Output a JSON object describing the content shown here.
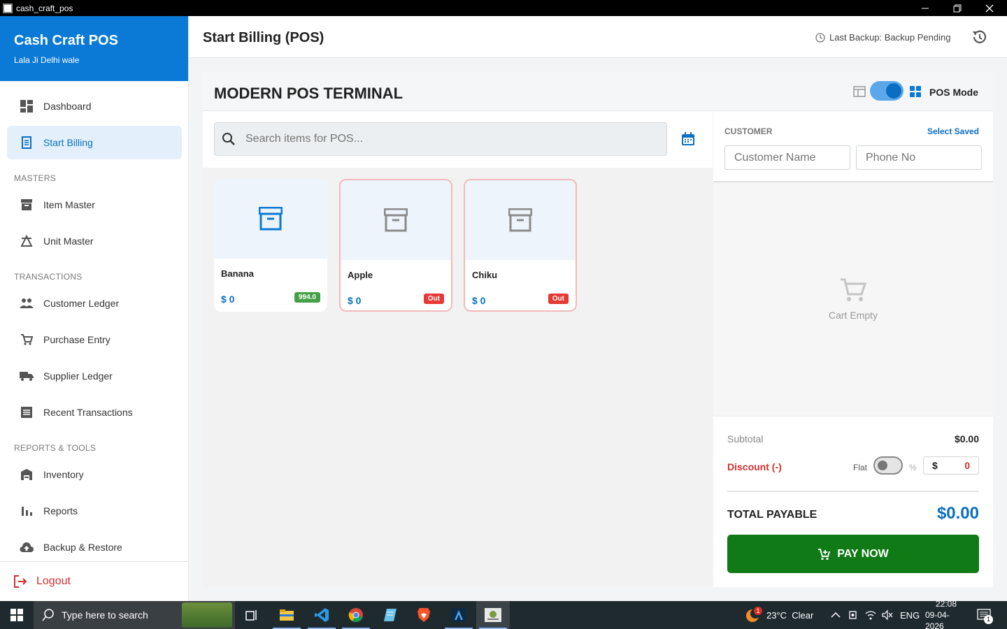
{
  "window": {
    "title": "cash_craft_pos"
  },
  "brand": {
    "name": "Cash Craft POS",
    "subtitle": "Lala Ji Delhi wale"
  },
  "nav": {
    "dashboard": "Dashboard",
    "start_billing": "Start Billing",
    "masters_section": "MASTERS",
    "item_master": "Item Master",
    "unit_master": "Unit Master",
    "transactions_section": "TRANSACTIONS",
    "customer_ledger": "Customer Ledger",
    "purchase_entry": "Purchase Entry",
    "supplier_ledger": "Supplier Ledger",
    "recent_transactions": "Recent Transactions",
    "reports_section": "REPORTS & TOOLS",
    "inventory": "Inventory",
    "reports": "Reports",
    "backup_restore": "Backup & Restore",
    "logout": "Logout"
  },
  "header": {
    "title": "Start Billing (POS)",
    "backup_status": "Last Backup: Backup Pending"
  },
  "terminal": {
    "title": "MODERN POS TERMINAL",
    "mode_label": "POS Mode",
    "pos_mode_on": true
  },
  "search": {
    "placeholder": "Search items for POS..."
  },
  "items": [
    {
      "name": "Banana",
      "price": "$ 0",
      "badge": "994.0",
      "status": "in-stock"
    },
    {
      "name": "Apple",
      "price": "$ 0",
      "badge": "Out",
      "status": "out-of-stock"
    },
    {
      "name": "Chiku",
      "price": "$ 0",
      "badge": "Out",
      "status": "out-of-stock"
    }
  ],
  "customer": {
    "label": "CUSTOMER",
    "select_saved": "Select Saved",
    "name_placeholder": "Customer Name",
    "phone_placeholder": "Phone No"
  },
  "cart": {
    "empty_text": "Cart Empty"
  },
  "totals": {
    "subtotal_label": "Subtotal",
    "subtotal_value": "$0.00",
    "discount_label": "Discount (-)",
    "flat_label": "Flat",
    "percent_label": "%",
    "discount_currency": "$",
    "discount_value": "0",
    "discount_percent_mode": false,
    "total_label": "TOTAL PAYABLE",
    "total_value": "$0.00",
    "pay_label": "PAY NOW"
  },
  "taskbar": {
    "search_text": "Type here to search",
    "weather": "23°C  Clear",
    "weather_badge": "1",
    "language": "ENG",
    "time": "22:08",
    "date": "09-04-2026",
    "notification_count": "1"
  },
  "colors": {
    "primary": "#0a7ad6",
    "pay": "#107a16",
    "danger": "#d32f2f"
  }
}
